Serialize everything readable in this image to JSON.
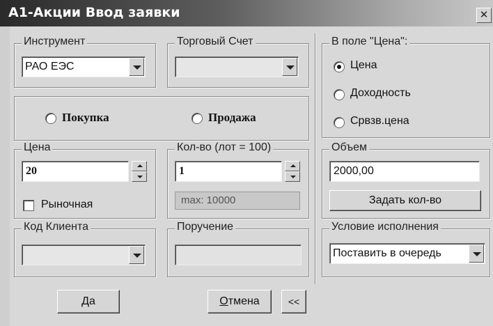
{
  "window": {
    "title": "A1-Акции Ввод заявки",
    "close_label": "✕"
  },
  "instrument": {
    "legend": "Инструмент",
    "value": "РАО ЕЭС"
  },
  "account": {
    "legend": "Торговый Счет",
    "value": ""
  },
  "price_field_mode": {
    "legend": "В поле \"Цена\":",
    "options": [
      {
        "label": "Цена",
        "selected": true
      },
      {
        "label": "Доходность",
        "selected": false
      },
      {
        "label": "Срвзв.цена",
        "selected": false
      }
    ]
  },
  "direction": {
    "buy_label": "Покупка",
    "sell_label": "Продажа"
  },
  "price": {
    "legend": "Цена",
    "value": "20",
    "market_label": "Рыночная",
    "market_checked": false
  },
  "quantity": {
    "legend": "Кол-во (лот = 100)",
    "value": "1",
    "max_label": "max: 10000"
  },
  "volume": {
    "legend": "Объем",
    "value": "2000,00",
    "set_qty_label": "Задать кол-во"
  },
  "client_code": {
    "legend": "Код Клиента",
    "value": ""
  },
  "instruction": {
    "legend": "Поручение",
    "value": ""
  },
  "execution": {
    "legend": "Условие исполнения",
    "value": "Поставить в очередь"
  },
  "buttons": {
    "ok_first": "Д",
    "ok_rest": "а",
    "cancel_first": "О",
    "cancel_rest": "тмена",
    "collapse": "<<"
  }
}
